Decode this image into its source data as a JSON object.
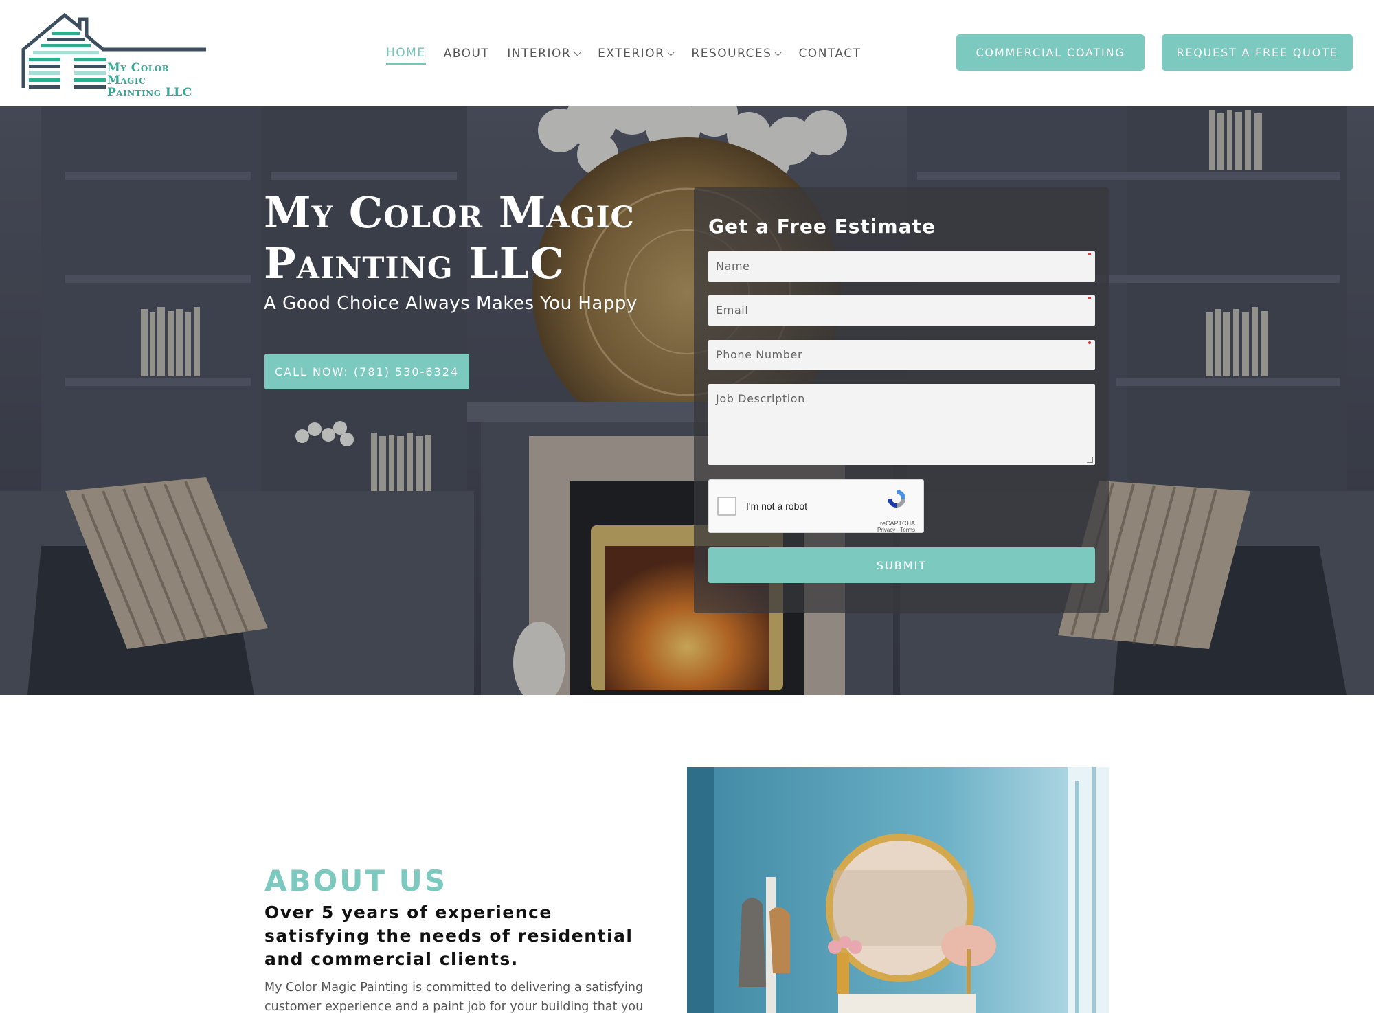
{
  "header": {
    "logo_text_line1": "My Color Magic",
    "logo_text_line2": "Painting LLC",
    "nav": [
      {
        "label": "HOME",
        "active": true,
        "dropdown": false
      },
      {
        "label": "ABOUT",
        "active": false,
        "dropdown": false
      },
      {
        "label": "INTERIOR",
        "active": false,
        "dropdown": true
      },
      {
        "label": "EXTERIOR",
        "active": false,
        "dropdown": true
      },
      {
        "label": "RESOURCES",
        "active": false,
        "dropdown": true
      },
      {
        "label": "CONTACT",
        "active": false,
        "dropdown": false
      }
    ],
    "commercial_button": "COMMERCIAL COATING",
    "quote_button": "REQUEST A FREE QUOTE"
  },
  "hero": {
    "title_line1": "My Color Magic",
    "title_line2": "Painting LLC",
    "subtitle": "A Good Choice Always Makes You Happy",
    "call_button": "CALL NOW: (781) 530-6324"
  },
  "form": {
    "title": "Get a Free Estimate",
    "name_placeholder": "Name",
    "email_placeholder": "Email",
    "phone_placeholder": "Phone Number",
    "job_placeholder": "Job Description",
    "captcha_label": "I'm not a robot",
    "captcha_brand": "reCAPTCHA",
    "captcha_terms": "Privacy - Terms",
    "submit_label": "SUBMIT"
  },
  "about": {
    "heading": "ABOUT US",
    "lead": "Over 5 years of experience satisfying the needs of residential and commercial clients.",
    "body": "My Color Magic Painting is committed to delivering a satisfying customer experience and a paint job for your building that you can"
  },
  "colors": {
    "accent": "#7cc9bf",
    "logo_green": "#37a896",
    "nav_text": "#555555"
  }
}
